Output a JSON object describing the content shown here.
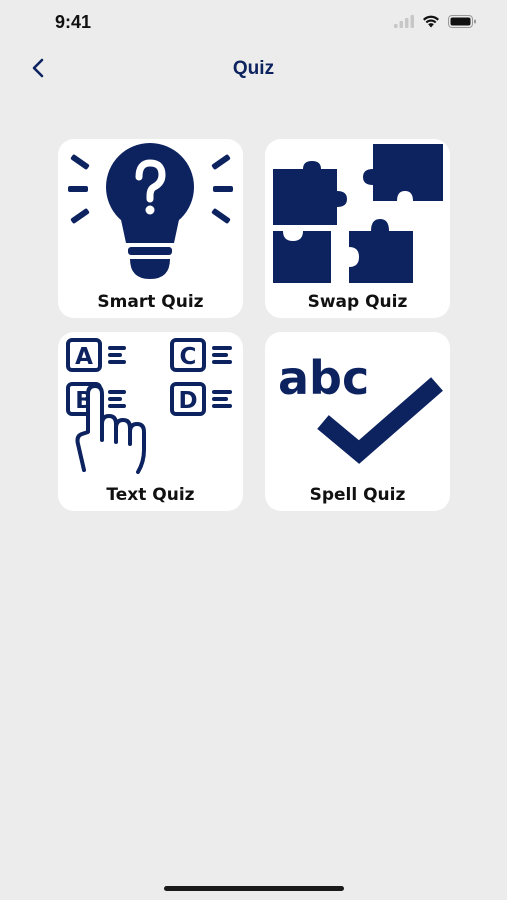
{
  "status_bar": {
    "time": "9:41",
    "icons": [
      "signal-icon",
      "wifi-icon",
      "battery-icon"
    ]
  },
  "nav": {
    "title": "Quiz",
    "back_icon": "chevron-left-icon"
  },
  "colors": {
    "accent": "#0d2360",
    "background": "#ececec",
    "card": "#ffffff"
  },
  "quizzes": [
    {
      "label": "Smart Quiz",
      "icon": "lightbulb-question-icon"
    },
    {
      "label": "Swap Quiz",
      "icon": "puzzle-icon"
    },
    {
      "label": "Text Quiz",
      "icon": "abcd-choice-icon"
    },
    {
      "label": "Spell Quiz",
      "icon": "abc-check-icon"
    }
  ]
}
